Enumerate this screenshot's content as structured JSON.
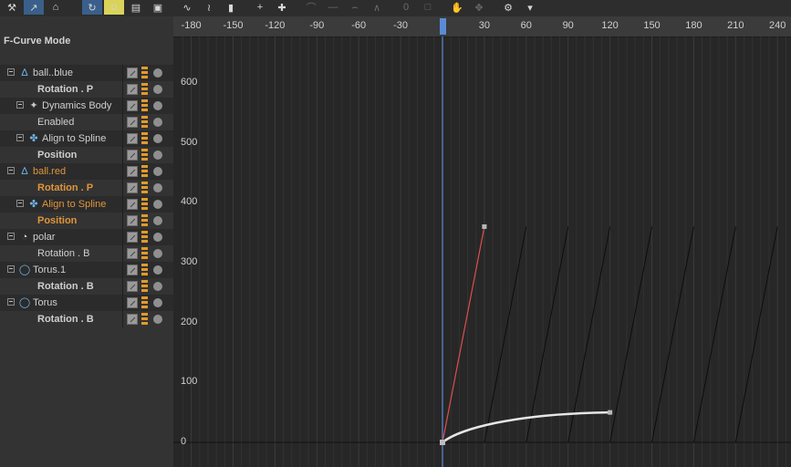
{
  "toolbar": {
    "icons": [
      "wrench-icon",
      "pointer-icon",
      "home-icon",
      "sep",
      "sep",
      "loop-icon",
      "person-icon",
      "folder-open-icon",
      "folder-key-icon",
      "sep",
      "curve-icon",
      "curve-break-icon",
      "lock-icon",
      "sep",
      "add-key-icon",
      "add-keys-icon",
      "sep",
      "tangent-icon",
      "tangent-flat-icon",
      "tangent-auto-icon",
      "tangent-break-icon",
      "sep",
      "zero-icon",
      "key-lock-icon",
      "sep",
      "grab-icon",
      "move-icon",
      "sep",
      "settings-icon",
      "fold-icon"
    ],
    "zero_label": "0"
  },
  "panel": {
    "mode_label": "F-Curve Mode"
  },
  "tree": [
    {
      "label": "ball..blue",
      "indent": 0,
      "expand": true,
      "icon": "figure-icon",
      "bold": false,
      "orange": false,
      "alt": true
    },
    {
      "label": "Rotation . P",
      "indent": 1,
      "expand": false,
      "icon": "",
      "bold": true,
      "orange": false,
      "alt": false
    },
    {
      "label": "Dynamics Body",
      "indent": 1,
      "expand": true,
      "icon": "dynamics-body-icon",
      "bold": false,
      "orange": false,
      "alt": true
    },
    {
      "label": "Enabled",
      "indent": 2,
      "expand": false,
      "icon": "",
      "bold": false,
      "orange": false,
      "alt": false
    },
    {
      "label": "Align to Spline",
      "indent": 1,
      "expand": true,
      "icon": "align-spline-icon",
      "bold": false,
      "orange": false,
      "alt": true
    },
    {
      "label": "Position",
      "indent": 2,
      "expand": false,
      "icon": "",
      "bold": true,
      "orange": false,
      "alt": false
    },
    {
      "label": "ball.red",
      "indent": 0,
      "expand": true,
      "icon": "figure-icon",
      "bold": false,
      "orange": true,
      "alt": true
    },
    {
      "label": "Rotation . P",
      "indent": 1,
      "expand": false,
      "icon": "",
      "bold": true,
      "orange": true,
      "alt": false
    },
    {
      "label": "Align to Spline",
      "indent": 1,
      "expand": true,
      "icon": "align-spline-icon",
      "bold": false,
      "orange": true,
      "alt": true
    },
    {
      "label": "Position",
      "indent": 2,
      "expand": false,
      "icon": "",
      "bold": true,
      "orange": true,
      "alt": false
    },
    {
      "label": "polar",
      "indent": 0,
      "expand": true,
      "icon": "polar-icon",
      "bold": false,
      "orange": false,
      "alt": true
    },
    {
      "label": "Rotation . B",
      "indent": 1,
      "expand": false,
      "icon": "",
      "bold": false,
      "orange": false,
      "alt": false
    },
    {
      "label": "Torus.1",
      "indent": 0,
      "expand": true,
      "icon": "torus-icon",
      "bold": false,
      "orange": false,
      "alt": true
    },
    {
      "label": "Rotation . B",
      "indent": 1,
      "expand": false,
      "icon": "",
      "bold": true,
      "orange": false,
      "alt": false
    },
    {
      "label": "Torus",
      "indent": 0,
      "expand": true,
      "icon": "torus-icon",
      "bold": false,
      "orange": false,
      "alt": true
    },
    {
      "label": "Rotation . B",
      "indent": 1,
      "expand": false,
      "icon": "",
      "bold": true,
      "orange": false,
      "alt": false
    }
  ],
  "graph": {
    "x_ticks": [
      "-180",
      "-150",
      "-120",
      "-90",
      "-60",
      "-30",
      "0",
      "30",
      "60",
      "90",
      "120",
      "150",
      "180",
      "210",
      "240"
    ],
    "y_ticks": [
      "600",
      "500",
      "400",
      "300",
      "200",
      "100",
      "0"
    ],
    "current_frame": 0,
    "colors": {
      "playhead": "#5b8bd6",
      "active_curve": "#e05050",
      "selected_curve": "#e6e6e6",
      "curves": "#0d0d0d"
    }
  }
}
